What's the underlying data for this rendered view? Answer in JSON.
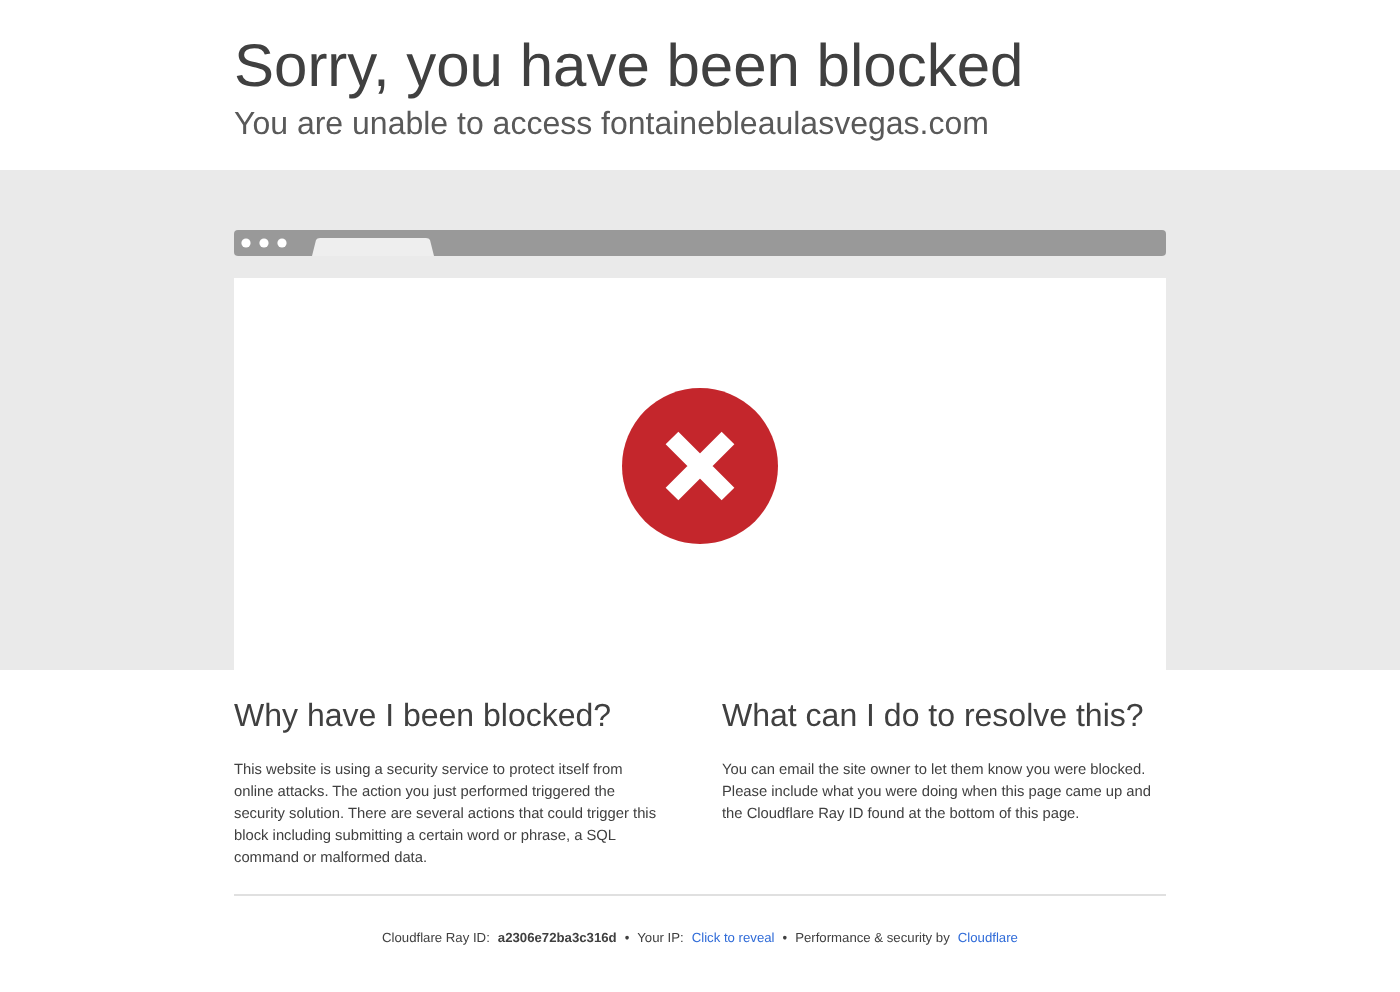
{
  "header": {
    "title": "Sorry, you have been blocked",
    "subtitle": "You are unable to access fontainebleaulasvegas.com"
  },
  "sections": [
    {
      "heading": "Why have I been blocked?",
      "body": "This website is using a security service to protect itself from online attacks. The action you just performed triggered the security solution. There are several actions that could trigger this block including submitting a certain word or phrase, a SQL command or malformed data."
    },
    {
      "heading": "What can I do to resolve this?",
      "body": "You can email the site owner to let them know you were blocked. Please include what you were doing when this page came up and the Cloudflare Ray ID found at the bottom of this page."
    }
  ],
  "footer": {
    "ray_label": "Cloudflare Ray ID:",
    "ray_id": "a2306e72ba3c316d",
    "separator_1": "•",
    "ip_label": "Your IP:",
    "ip_link": "Click to reveal",
    "separator_2": "•",
    "perf_label": "Performance & security by",
    "perf_link": "Cloudflare"
  }
}
